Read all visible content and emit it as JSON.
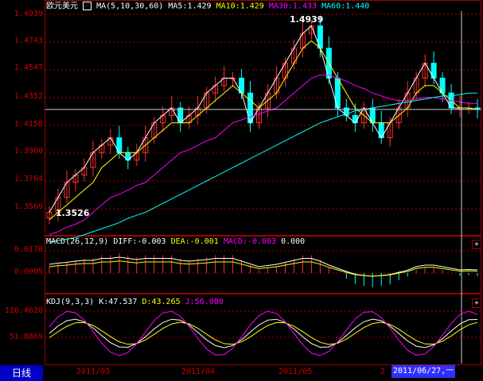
{
  "symbol": "欧元美元",
  "ma_legend": {
    "icon": "ma-icon",
    "params": "MA(5,10,30,60)",
    "ma5": "MA5:1.429",
    "ma10": "MA10:1.429",
    "ma30": "MA30:1.433",
    "ma60": "MA60:1.440"
  },
  "price_axis": [
    "1.4939",
    "1.4743",
    "1.4547",
    "1.4352",
    "1.4158",
    "1.3960",
    "1.3764",
    "1.3569"
  ],
  "high_label": "1.4939",
  "low_label": "1.3526",
  "macd_legend": {
    "params": "MACD(26,12,9)",
    "diff": "DIFF:-0.003",
    "dea": "DEA:-0.001",
    "macd": "MACD:-0.003",
    "extra": "0.000"
  },
  "macd_axis": [
    "0.0178",
    "0.0005"
  ],
  "kdj_legend": {
    "params": "KDJ(9,3,3)",
    "k": "K:47.537",
    "d": "D:43.265",
    "j": "J:56.080"
  },
  "kdj_axis": [
    "116.4620",
    "51.8869"
  ],
  "period_tab": "日线",
  "date_axis": [
    "2011/03",
    "2011/04",
    "2011/05",
    "2"
  ],
  "cursor_date": "2011/06/27,一",
  "buttons": {
    "macd_expand": "+",
    "kdj_expand": "+"
  },
  "colors": {
    "up": "#ff3030",
    "down": "#00ffff",
    "ma5": "#ffffff",
    "ma10": "#ffff00",
    "ma30": "#ff00ff",
    "ma60": "#00ffff",
    "grid": "#a00000",
    "axis_text": "#d00000"
  },
  "chart_data": {
    "type": "candlestick",
    "series": [
      {
        "name": "MA5",
        "values": [
          1.36,
          1.37,
          1.38,
          1.385,
          1.39,
          1.4,
          1.405,
          1.41,
          1.4,
          1.395,
          1.4,
          1.41,
          1.42,
          1.425,
          1.43,
          1.42,
          1.425,
          1.43,
          1.44,
          1.445,
          1.45,
          1.45,
          1.44,
          1.42,
          1.43,
          1.44,
          1.45,
          1.46,
          1.47,
          1.48,
          1.485,
          1.47,
          1.45,
          1.43,
          1.425,
          1.42,
          1.43,
          1.42,
          1.41,
          1.42,
          1.43,
          1.44,
          1.45,
          1.46,
          1.45,
          1.44,
          1.43,
          1.43,
          1.43,
          1.429
        ]
      },
      {
        "name": "MA10",
        "values": [
          1.355,
          1.36,
          1.365,
          1.37,
          1.375,
          1.38,
          1.39,
          1.395,
          1.4,
          1.4,
          1.4,
          1.405,
          1.41,
          1.415,
          1.42,
          1.42,
          1.42,
          1.425,
          1.43,
          1.435,
          1.44,
          1.445,
          1.44,
          1.435,
          1.43,
          1.435,
          1.44,
          1.45,
          1.46,
          1.47,
          1.475,
          1.47,
          1.46,
          1.45,
          1.44,
          1.43,
          1.425,
          1.42,
          1.42,
          1.42,
          1.425,
          1.43,
          1.44,
          1.445,
          1.445,
          1.44,
          1.435,
          1.43,
          1.43,
          1.429
        ]
      },
      {
        "name": "MA30",
        "values": [
          1.345,
          1.347,
          1.35,
          1.352,
          1.355,
          1.36,
          1.365,
          1.37,
          1.372,
          1.375,
          1.378,
          1.38,
          1.385,
          1.39,
          1.395,
          1.4,
          1.402,
          1.405,
          1.408,
          1.41,
          1.415,
          1.42,
          1.422,
          1.424,
          1.426,
          1.428,
          1.43,
          1.435,
          1.44,
          1.445,
          1.45,
          1.452,
          1.452,
          1.45,
          1.448,
          1.445,
          1.443,
          1.44,
          1.438,
          1.436,
          1.435,
          1.435,
          1.436,
          1.437,
          1.437,
          1.436,
          1.435,
          1.434,
          1.433,
          1.433
        ]
      },
      {
        "name": "MA60",
        "values": [
          1.34,
          1.341,
          1.342,
          1.343,
          1.345,
          1.347,
          1.349,
          1.351,
          1.353,
          1.356,
          1.358,
          1.36,
          1.363,
          1.366,
          1.369,
          1.372,
          1.375,
          1.378,
          1.381,
          1.384,
          1.387,
          1.39,
          1.393,
          1.396,
          1.399,
          1.402,
          1.405,
          1.408,
          1.411,
          1.414,
          1.417,
          1.42,
          1.422,
          1.424,
          1.426,
          1.428,
          1.429,
          1.43,
          1.431,
          1.432,
          1.433,
          1.434,
          1.435,
          1.436,
          1.437,
          1.438,
          1.438,
          1.439,
          1.44,
          1.44
        ]
      }
    ],
    "ylim": [
      1.348,
      1.496
    ],
    "grid": true
  }
}
